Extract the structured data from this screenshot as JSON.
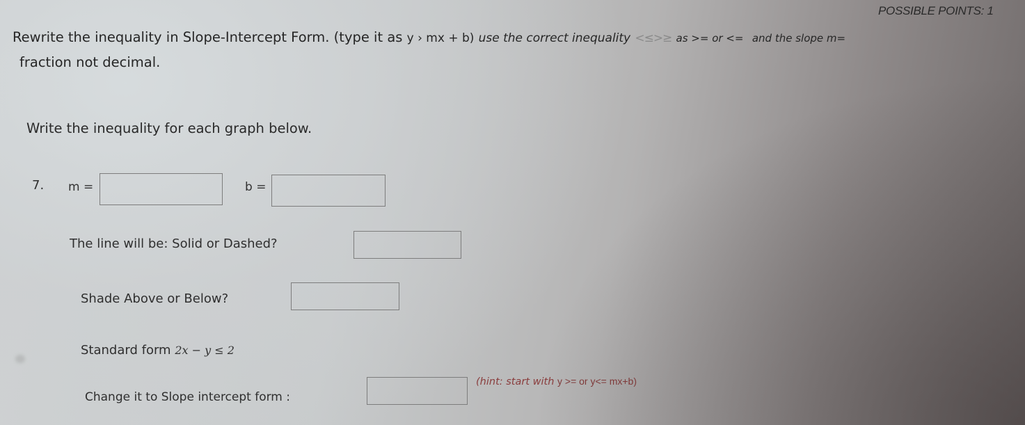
{
  "header": {
    "possible_points_label": "POSSIBLE POINTS: 1"
  },
  "instructions": {
    "part1": "Rewrite the inequality in Slope-Intercept Form. (type it as",
    "example_form": "y › mx + b)",
    "part2": "use the correct inequality",
    "symbols": "<≤>≥",
    "part3": "as >= or <=",
    "part4": "and the slope m=",
    "line2": "fraction not decimal."
  },
  "heading": "Write the inequality for each graph below.",
  "question": {
    "number": "7.",
    "m_label": "m =",
    "m_value": "",
    "b_label": "b =",
    "b_value": "",
    "line_type_label": "The line will be: Solid or Dashed?",
    "line_type_value": "",
    "shade_label": "Shade Above or Below?",
    "shade_value": "",
    "standard_form_label": "Standard form",
    "standard_form_expr": "2x − y ≤ 2",
    "slope_intercept_label": "Change it to Slope intercept form :",
    "slope_intercept_value": "",
    "hint_prefix": "(hint: start with",
    "hint_math": "y >= or y<=   mx+b)"
  },
  "colors": {
    "hint": "#8a3d3d",
    "symbols": "#8b8b8b",
    "text": "#2b2b2b",
    "box_border": "#7d7d7d"
  }
}
